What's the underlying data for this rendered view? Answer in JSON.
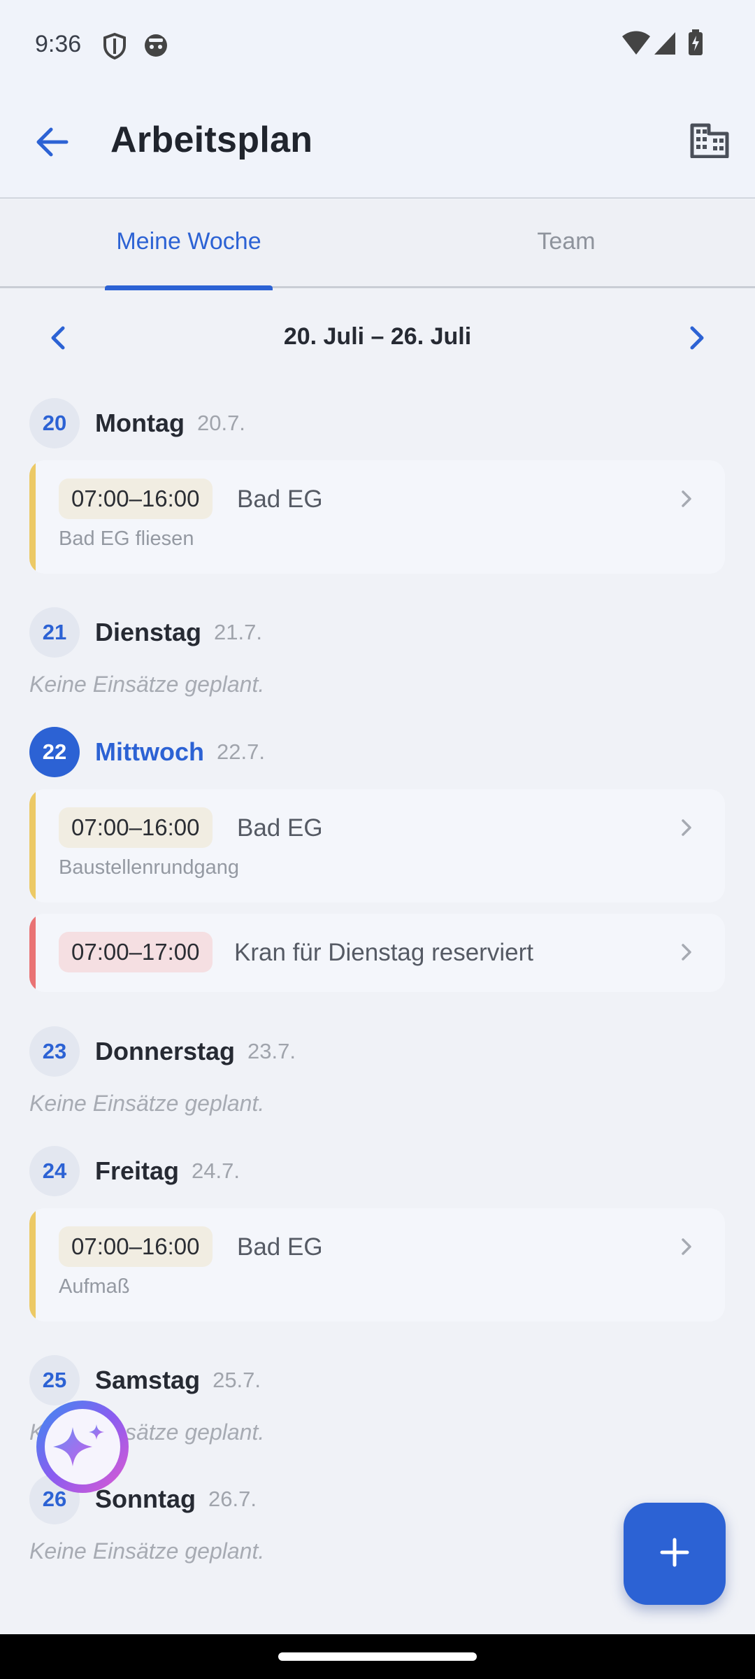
{
  "status_bar": {
    "time": "9:36"
  },
  "app_bar": {
    "title": "Arbeitsplan"
  },
  "tabs": [
    {
      "label": "Meine Woche",
      "active": true
    },
    {
      "label": "Team",
      "active": false
    }
  ],
  "week": {
    "label": "20. Juli – 26. Juli"
  },
  "days": [
    {
      "num": "20",
      "name": "Montag",
      "date": "20.7.",
      "empty": "",
      "shifts": [
        {
          "time": "07:00–16:00",
          "title": "Bad EG",
          "subtitle": "Bad EG fliesen"
        }
      ]
    },
    {
      "num": "21",
      "name": "Dienstag",
      "date": "21.7.",
      "empty": "Keine Einsätze geplant.",
      "shifts": []
    },
    {
      "num": "22",
      "name": "Mittwoch",
      "date": "22.7.",
      "empty": "",
      "today": true,
      "shifts": [
        {
          "time": "07:00–16:00",
          "title": "Bad EG",
          "subtitle": "Baustellenrundgang"
        },
        {
          "time": "07:00–17:00",
          "title": "Kran für Dienstag reserviert",
          "subtitle": ""
        }
      ]
    },
    {
      "num": "23",
      "name": "Donnerstag",
      "date": "23.7.",
      "empty": "Keine Einsätze geplant.",
      "shifts": []
    },
    {
      "num": "24",
      "name": "Freitag",
      "date": "24.7.",
      "empty": "",
      "shifts": [
        {
          "time": "07:00–16:00",
          "title": "Bad EG",
          "subtitle": "Aufmaß"
        }
      ]
    },
    {
      "num": "25",
      "name": "Samstag",
      "date": "25.7.",
      "empty": "Keine Einsätze geplant.",
      "shifts": []
    },
    {
      "num": "26",
      "name": "Sonntag",
      "date": "26.7.",
      "empty": "Keine Einsätze geplant.",
      "shifts": []
    }
  ],
  "colors": {
    "accent": "#2c62d4",
    "shift_yellow": "#ecc965",
    "shift_red": "#e97374"
  },
  "icons": {
    "back": "arrow-left-icon",
    "building": "building-icon",
    "prev_week": "chevron-left-icon",
    "next_week": "chevron-right-icon",
    "ai_assistant": "sparkle-icon",
    "add": "plus-icon"
  }
}
